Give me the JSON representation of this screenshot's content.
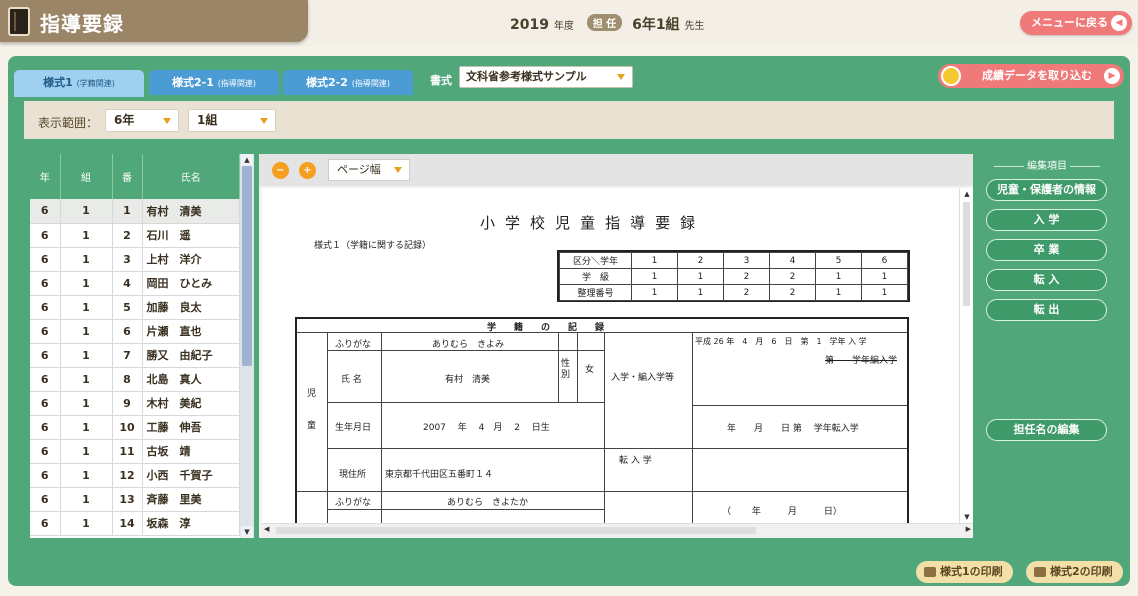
{
  "header": {
    "title": "指導要録",
    "year": "2019",
    "year_unit": "年度",
    "tanto_badge": "担 任",
    "class_name": "6年1組",
    "sensei": "先生",
    "menu_button": "メニューに戻る"
  },
  "tabs": [
    {
      "label": "様式1",
      "sub": "(学籍関連)"
    },
    {
      "label": "様式2-1",
      "sub": "(指導関連)"
    },
    {
      "label": "様式2-2",
      "sub": "(指導関連)"
    }
  ],
  "format": {
    "label": "書式",
    "value": "文科省参考様式サンプル"
  },
  "import_button": "成績データを取り込む",
  "range": {
    "label": "表示範囲：",
    "grade": "6年",
    "class": "1組"
  },
  "students": {
    "headers": [
      "年",
      "組",
      "番",
      "氏名"
    ],
    "rows": [
      [
        "6",
        "1",
        "1",
        "有村　清美"
      ],
      [
        "6",
        "1",
        "2",
        "石川　遥"
      ],
      [
        "6",
        "1",
        "3",
        "上村　洋介"
      ],
      [
        "6",
        "1",
        "4",
        "岡田　ひとみ"
      ],
      [
        "6",
        "1",
        "5",
        "加藤　良太"
      ],
      [
        "6",
        "1",
        "6",
        "片瀬　直也"
      ],
      [
        "6",
        "1",
        "7",
        "勝又　由紀子"
      ],
      [
        "6",
        "1",
        "8",
        "北島　真人"
      ],
      [
        "6",
        "1",
        "9",
        "木村　美紀"
      ],
      [
        "6",
        "1",
        "10",
        "工藤　伸吾"
      ],
      [
        "6",
        "1",
        "11",
        "古坂　靖"
      ],
      [
        "6",
        "1",
        "12",
        "小西　千賀子"
      ],
      [
        "6",
        "1",
        "13",
        "斉藤　里美"
      ],
      [
        "6",
        "1",
        "14",
        "坂森　淳"
      ]
    ]
  },
  "viewer": {
    "page_select": "ページ幅"
  },
  "doc": {
    "title_chars": [
      "小",
      "学",
      "校",
      "児",
      "童",
      "指",
      "導",
      "要",
      "録"
    ],
    "subtitle": "様式１（学籍に関する記録）",
    "grade_table": {
      "header": [
        "区分＼学年",
        "1",
        "2",
        "3",
        "4",
        "5",
        "6"
      ],
      "rows": [
        [
          "学　級",
          "1",
          "1",
          "2",
          "2",
          "1",
          "1"
        ],
        [
          "整理番号",
          "1",
          "1",
          "2",
          "2",
          "1",
          "1"
        ]
      ]
    },
    "record_title": "学　　籍　　の　　記　　録",
    "jido": "児",
    "jido2": "童",
    "furigana_label": "ふりがな",
    "furigana_value": "ありむら　きよみ",
    "name_label": "氏 名",
    "name_value": "有村　清美",
    "sex_label": "性別",
    "sex_value": "女",
    "birth_label": "生年月日",
    "birth_value": "2007　 年　 4　月　 2　 日生",
    "address_label": "現住所",
    "address_value": "東京都千代田区五番町１４",
    "admission_label": "入学・編入学等",
    "admission_value": "平成 26 年　4　月　6　日　第　1　学年 入 学",
    "admission_strike": "第　　学年編入学",
    "transfer_label": "転 入 学",
    "transfer_value": "年　　月　　日 第　 学年転入学",
    "transfer_paren": "（　　 年　　　月　　　日）",
    "guardian_furigana": "ありむら　きよたか"
  },
  "edit": {
    "label": "編集項目",
    "buttons": [
      "児童・保護者の情報",
      "入 学",
      "卒 業",
      "転 入",
      "転 出"
    ],
    "teacher_button": "担任名の編集"
  },
  "print": {
    "form1": "様式1の印刷",
    "form2": "様式2の印刷"
  }
}
